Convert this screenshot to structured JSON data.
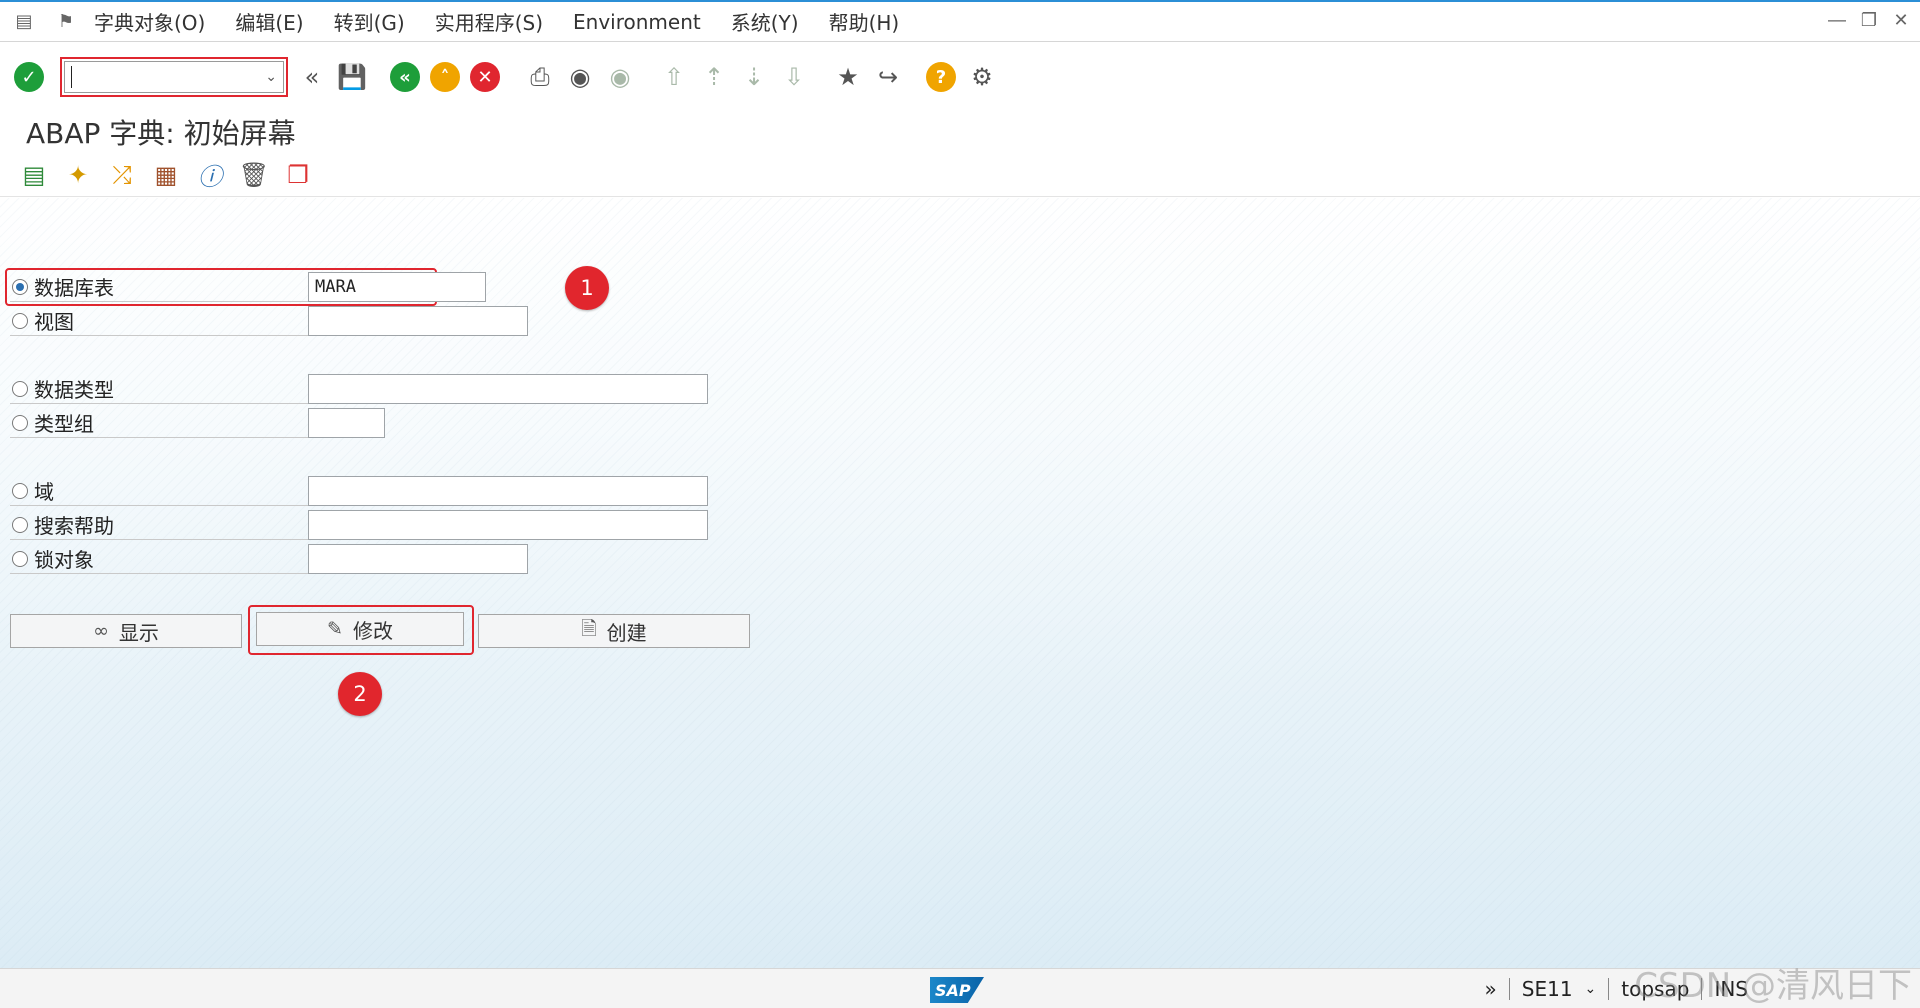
{
  "menubar": {
    "items": [
      "字典对象(O)",
      "编辑(E)",
      "转到(G)",
      "实用程序(S)",
      "Environment",
      "系统(Y)",
      "帮助(H)"
    ]
  },
  "page": {
    "title": "ABAP 字典: 初始屏幕"
  },
  "form": {
    "rows": [
      {
        "label": "数据库表",
        "value": "MARA",
        "selected": true
      },
      {
        "label": "视图",
        "value": "",
        "selected": false
      },
      {
        "label": "数据类型",
        "value": "",
        "selected": false
      },
      {
        "label": "类型组",
        "value": "",
        "selected": false
      },
      {
        "label": "域",
        "value": "",
        "selected": false
      },
      {
        "label": "搜索帮助",
        "value": "",
        "selected": false
      },
      {
        "label": "锁对象",
        "value": "",
        "selected": false
      }
    ]
  },
  "buttons": {
    "display": "显示",
    "change": "修改",
    "create": "创建"
  },
  "annotations": {
    "badge1": "1",
    "badge2": "2"
  },
  "statusbar": {
    "sap": "SAP",
    "transaction": "SE11",
    "system": "topsap",
    "mode": "INS"
  },
  "watermark": "CSDN @清风日下"
}
